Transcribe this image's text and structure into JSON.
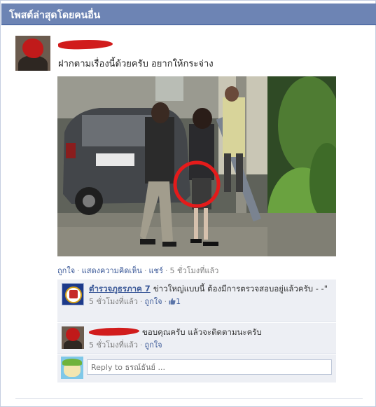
{
  "header": {
    "title": "โพสต์ล่าสุดโดยคนอื่น"
  },
  "post": {
    "text": "ฝากตามเรื่องนี้ด้วยครับ อยากให้กระจ่าง",
    "actions": {
      "like": "ถูกใจ",
      "comment": "แสดงความคิดเห็น",
      "share": "แชร์",
      "timestamp": "5 ชั่วโมงที่แล้ว"
    }
  },
  "comments": [
    {
      "author": "ตำรวจภูธรภาค 7",
      "text": "ข่าวใหญ่แบบนี้ ต้องมีการตรวจสอบอยู่แล้วครับ - -\"",
      "timestamp": "5 ชั่วโมงที่แล้ว",
      "like": "ถูกใจ",
      "likes_count": "1"
    },
    {
      "text": "ขอบคุณครับ แล้วจะติดตามนะครับ",
      "timestamp": "5 ชั่วโมงที่แล้ว",
      "like": "ถูกใจ"
    }
  ],
  "reply": {
    "placeholder": "Reply to ธรณ์ธันย์ ..."
  },
  "colors": {
    "header_bg": "#6d84b4",
    "link": "#3b5998",
    "comment_bg": "#edeff4",
    "highlight_circle": "#e41b1b"
  },
  "icons": [
    "thumbs-up-icon"
  ]
}
